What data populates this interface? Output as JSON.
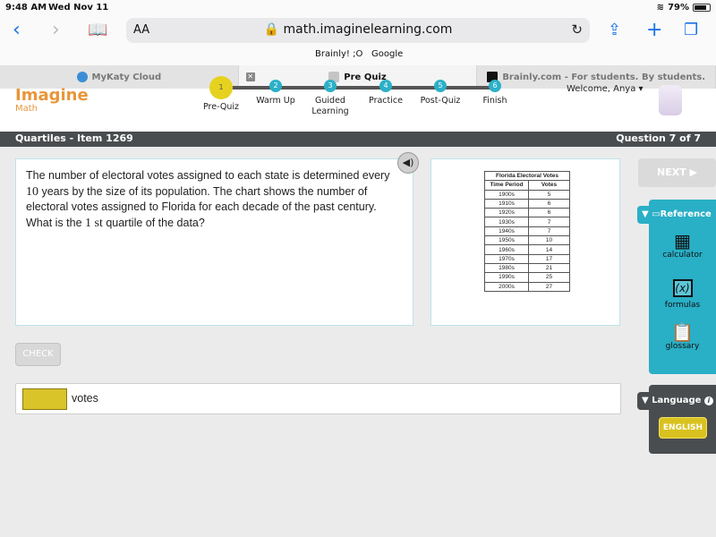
{
  "status_bar": {
    "time": "9:48 AM",
    "date": "Wed Nov 11",
    "battery": "79%",
    "battery_level": 0.79
  },
  "browser": {
    "text_size_label": "AA",
    "url": "math.imaginelearning.com",
    "bookmarks": [
      "Brainly! ;O",
      "Google"
    ],
    "tabs": [
      {
        "label": "MyKaty Cloud",
        "active": false
      },
      {
        "label": "Pre Quiz",
        "active": true
      },
      {
        "label": "Brainly.com - For students. By students.",
        "active": false
      }
    ]
  },
  "app": {
    "logo_title": "Imagine",
    "logo_subtitle": "Math",
    "steps": [
      {
        "number": "1",
        "label": "Pre-Quiz",
        "current": true
      },
      {
        "number": "2",
        "label": "Warm Up",
        "current": false
      },
      {
        "number": "3",
        "label": "Guided Learning",
        "current": false
      },
      {
        "number": "4",
        "label": "Practice",
        "current": false
      },
      {
        "number": "5",
        "label": "Post-Quiz",
        "current": false
      },
      {
        "number": "6",
        "label": "Finish",
        "current": false
      }
    ],
    "welcome": "Welcome, Anya",
    "lesson_title": "Quartiles - Item 1269",
    "question_counter": "Question 7 of 7"
  },
  "question": {
    "text_part1": "The number of electoral votes assigned to each state is determined every ",
    "num_10": "10",
    "text_part2": " years by the size of its population. The chart shows the number of electoral votes assigned to Florida for each decade of the past century. What is the ",
    "ordinal": "1 st",
    "text_part3": " quartile of the data?"
  },
  "table": {
    "title": "Florida Electoral Votes",
    "headers": [
      "Time Period",
      "Votes"
    ],
    "rows": [
      [
        "1900s",
        "5"
      ],
      [
        "1910s",
        "6"
      ],
      [
        "1920s",
        "6"
      ],
      [
        "1930s",
        "7"
      ],
      [
        "1940s",
        "7"
      ],
      [
        "1950s",
        "10"
      ],
      [
        "1960s",
        "14"
      ],
      [
        "1970s",
        "17"
      ],
      [
        "1980s",
        "21"
      ],
      [
        "1990s",
        "25"
      ],
      [
        "2000s",
        "27"
      ]
    ]
  },
  "buttons": {
    "next": "NEXT ▶",
    "check": "CHECK",
    "english": "ENGLISH"
  },
  "reference": {
    "title": "Reference",
    "items": [
      {
        "label": "calculator"
      },
      {
        "label": "formulas"
      },
      {
        "label": "glossary"
      }
    ]
  },
  "language": {
    "title": "Language"
  },
  "answer": {
    "value": "",
    "unit": "votes"
  },
  "colors": {
    "accent": "#29afc6",
    "brand": "#e8963a",
    "highlight": "#d9c42a",
    "dark_bar": "#4a4d4f"
  }
}
